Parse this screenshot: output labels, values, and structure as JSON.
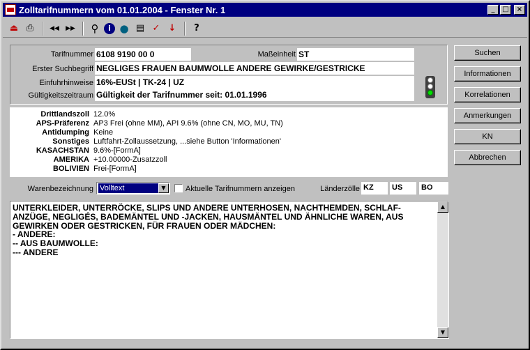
{
  "window": {
    "title": "Zolltarifnummern vom 01.01.2004 - Fenster Nr. 1",
    "caption_buttons": [
      "_",
      "□",
      "×"
    ]
  },
  "toolbar": {
    "icons": [
      "import-icon",
      "print-icon",
      "back-icon",
      "forward-icon",
      "search-icon",
      "info-icon",
      "globe-icon",
      "comment-icon",
      "spellcheck-icon",
      "sort-icon",
      "help-icon"
    ],
    "glyphs": {
      "import": "⏏",
      "print": "⎙",
      "back": "◀◀",
      "forward": "▶▶",
      "search": "⚲",
      "info": "i",
      "globe": "●",
      "comment": "▤",
      "spell": "✓",
      "sort": "↓",
      "help": "?"
    }
  },
  "fields": {
    "tarifnummer_label": "Tarifnummer",
    "tarifnummer": "6108 9190 00 0",
    "masseinheit_label": "Maßeinheit",
    "masseinheit": "ST",
    "suchbegriff_label": "Erster Suchbegriff",
    "suchbegriff": "NEGLIGES FRAUEN BAUMWOLLE ANDERE GEWIRKE/GESTRICKE",
    "einfuhr_label": "Einfuhrhinweise",
    "einfuhr": "16%-EUSt | TK-24 | UZ",
    "gueltig_label": "Gültigkeitszeitraum",
    "gueltig": "Gültigkeit der Tarifnummer seit: 01.01.1996"
  },
  "duties": [
    {
      "label": "Drittlandszoll",
      "value": "12.0%"
    },
    {
      "label": "APS-Präferenz",
      "value": "AP3 Frei (ohne MM), API 9.6% (ohne CN, MO, MU, TN)"
    },
    {
      "label": "Antidumping",
      "value": "Keine"
    },
    {
      "label": "Sonstiges",
      "value": "Luftfahrt-Zollaussetzung, ...siehe Button 'Informationen'"
    },
    {
      "label": "KASACHSTAN",
      "value": "9.6%-[FormA]"
    },
    {
      "label": "AMERIKA",
      "value": "+10.00000-Zusatzzoll"
    },
    {
      "label": "BOLIVIEN",
      "value": "Frei-[FormA]"
    }
  ],
  "warenbezeichnung": {
    "label": "Warenbezeichnung",
    "selected": "Volltext",
    "checkbox_label": "Aktuelle Tarifnummern anzeigen",
    "checkbox_checked": false,
    "laender_label": "Länderzölle",
    "countries": [
      "KZ",
      "US",
      "BO"
    ]
  },
  "description": "UNTERKLEIDER, UNTERRÖCKE, SLIPS UND ANDERE UNTERHOSEN, NACHTHEMDEN, SCHLAF-\nANZÜGE, NEGLIGÉS, BADEMÄNTEL UND -JACKEN, HAUSMÄNTEL UND ÄHNLICHE WAREN, AUS\nGEWIRKEN ODER GESTRICKEN, FÜR FRAUEN ODER MÄDCHEN:\n- ANDERE:\n-- AUS BAUMWOLLE:\n--- ANDERE",
  "scroll": {
    "up": "▲",
    "down": "▼"
  },
  "side_buttons": [
    {
      "label": "Suchen"
    },
    {
      "label": "Informationen"
    },
    {
      "label": "Korrelationen"
    },
    {
      "label": "Anmerkungen"
    },
    {
      "label": "KN"
    },
    {
      "label": "Abbrechen"
    }
  ],
  "colors": {
    "title_bar": "#000080",
    "window_bg": "#c0c0c0",
    "field_bg": "#ffffff",
    "selection": "#000080"
  }
}
